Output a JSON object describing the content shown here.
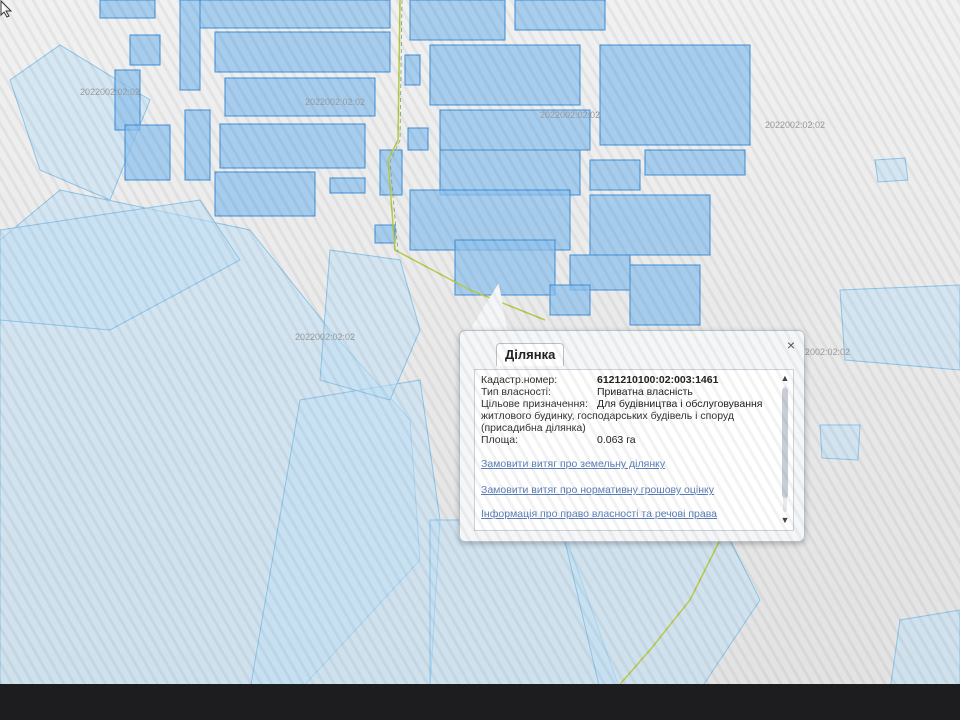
{
  "map": {
    "quarter_labels": [
      "2022002:02:02",
      "2022002:02:02",
      "2022002:02:02",
      "2022002:02:02",
      "2022002:02:02",
      "2022002:02:02"
    ]
  },
  "popup": {
    "tab_label": "Ділянка",
    "close_symbol": "×",
    "fields": [
      {
        "label": "Кадастр.номер:",
        "value": "6121210100:02:003:1461"
      },
      {
        "label": "Тип власності:",
        "value": "Приватна власність"
      },
      {
        "label": "Цільове призначення:",
        "value": "Для будівництва і обслуговування"
      }
    ],
    "purpose_continuation": [
      "житлового будинку, господарських будівель і споруд",
      "(присадибна ділянка)"
    ],
    "area": {
      "label": "Площа:",
      "value": "0.063 га"
    },
    "links": [
      "Замовити витяг про земельну ділянку",
      "Замовити витяг про нормативну грошову оцінку",
      "Інформація про право власності та речові права"
    ]
  },
  "colors": {
    "parcel_fill": "#8fc2ee",
    "parcel_stroke": "#3e8fd6",
    "road_line": "#b8c94a",
    "link": "#5a7fb8"
  },
  "icons": {
    "close": "close-icon",
    "scroll_up": "chevron-up-icon",
    "scroll_down": "chevron-down-icon",
    "cursor": "mouse-pointer-icon"
  }
}
